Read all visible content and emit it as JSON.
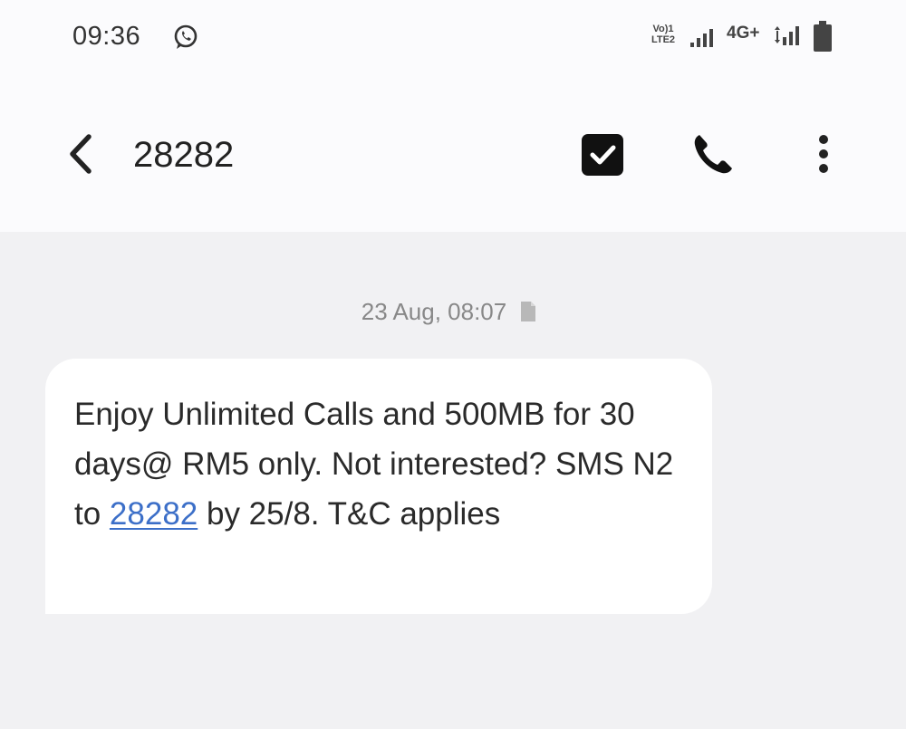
{
  "status_bar": {
    "time": "09:36",
    "volte_line1": "Vo)1",
    "volte_line2": "LTE2",
    "network": "4G+",
    "icons": [
      "whatsapp-icon",
      "signal-icon",
      "signal-icon",
      "battery-icon"
    ]
  },
  "toolbar": {
    "title": "28282",
    "icons": [
      "back-arrow-icon",
      "checkbox-icon",
      "phone-icon",
      "more-vertical-icon"
    ]
  },
  "conversation": {
    "date_label": "23 Aug, 08:07",
    "date_icon": "document-icon",
    "message": {
      "text_before_link": "Enjoy Unlimited Calls and 500MB for 30 days@ RM5 only. Not interested? SMS N2 to ",
      "link_text": "28282",
      "text_after_link": " by 25/8. T&C applies"
    }
  },
  "colors": {
    "header_bg": "#fbfbfd",
    "chat_bg": "#f1f1f3",
    "bubble_bg": "#ffffff",
    "link": "#3c6fc8"
  }
}
